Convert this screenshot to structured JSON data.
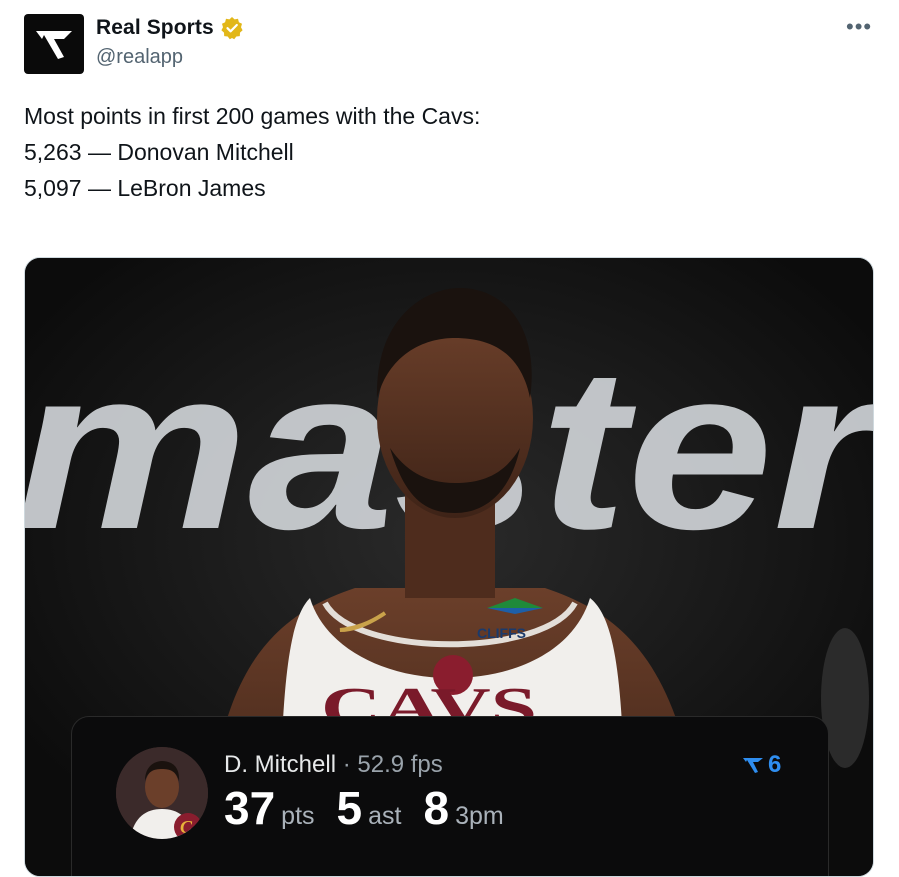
{
  "account": {
    "display_name": "Real Sports",
    "handle": "@realapp",
    "verified": true,
    "logo_icon": "real-sports-logo"
  },
  "menu": {
    "more_label": "•••"
  },
  "tweet": {
    "lines": [
      "Most points in first 200 games with the Cavs:",
      "",
      "5,263 — Donovan Mitchell",
      "5,097 — LeBron James"
    ]
  },
  "media": {
    "background_text": "master",
    "jersey_sponsor": "CLIFFS",
    "jersey_text": "CAVS",
    "card": {
      "player": "D. Mitchell",
      "separator": "·",
      "fps": "52.9 fps",
      "badge_count": "6",
      "stats": [
        {
          "value": "37",
          "unit": "pts"
        },
        {
          "value": "5",
          "unit": "ast"
        },
        {
          "value": "8",
          "unit": "3pm"
        }
      ]
    }
  },
  "colors": {
    "accent": "#2f8ef0",
    "verified": "#e2b719",
    "card_bg": "#0b0b0c"
  }
}
